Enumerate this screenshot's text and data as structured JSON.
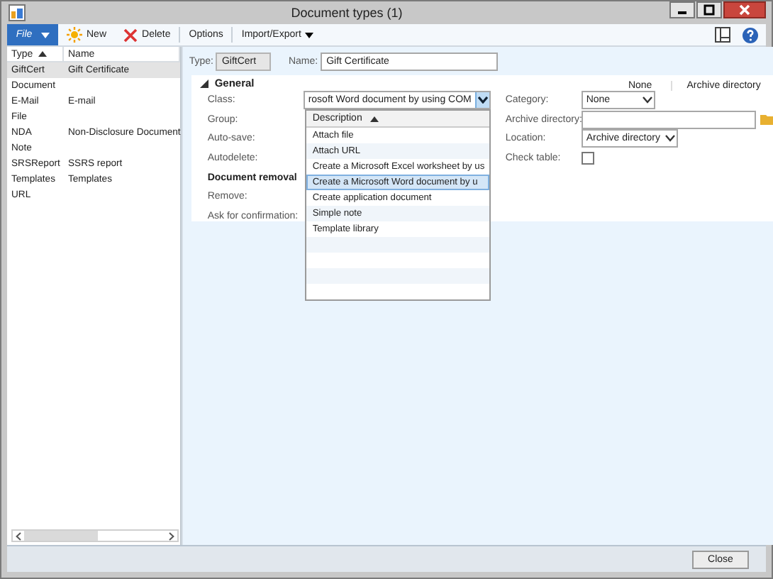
{
  "window": {
    "title": "Document types (1)"
  },
  "toolbar": {
    "file_menu": "File",
    "buttons": [
      {
        "kind": "new",
        "label": "New"
      },
      {
        "kind": "delete",
        "label": "Delete"
      },
      {
        "kind": "plain",
        "label": "Options"
      },
      {
        "kind": "menu",
        "label": "Import/Export"
      }
    ]
  },
  "list": {
    "columns": [
      "Type",
      "Name"
    ],
    "rows": [
      {
        "type": "GiftCert",
        "name": "Gift Certificate",
        "selected": true
      },
      {
        "type": "Document",
        "name": "",
        "selected": false
      },
      {
        "type": "E-Mail",
        "name": "E-mail",
        "selected": false
      },
      {
        "type": "File",
        "name": "",
        "selected": false
      },
      {
        "type": "NDA",
        "name": "Non-Disclosure Document",
        "selected": false
      },
      {
        "type": "Note",
        "name": "",
        "selected": false
      },
      {
        "type": "SRSReport",
        "name": "SSRS report",
        "selected": false
      },
      {
        "type": "Templates",
        "name": "Templates",
        "selected": false
      },
      {
        "type": "URL",
        "name": "",
        "selected": false
      }
    ]
  },
  "header": {
    "type_label": "Type:",
    "type_value": "GiftCert",
    "name_label": "Name:",
    "name_value": "Gift Certificate"
  },
  "general": {
    "title": "General",
    "expanded": true,
    "top_labels": [
      "None",
      "Archive directory"
    ],
    "left_fields": [
      {
        "kind": "combo",
        "label": "Class:",
        "value": "rosoft Word document by using COM"
      },
      {
        "kind": "label",
        "label": "Group:"
      },
      {
        "kind": "label",
        "label": "Auto-save:"
      },
      {
        "kind": "label",
        "label": "Autodelete:"
      },
      {
        "kind": "heading",
        "label": "Document removal"
      },
      {
        "kind": "label",
        "label": "Remove:"
      },
      {
        "kind": "label",
        "label": "Ask for confirmation:"
      }
    ],
    "right_fields": [
      {
        "kind": "combo",
        "label": "Category:",
        "value": "None"
      },
      {
        "kind": "folder",
        "label": "Archive directory:"
      },
      {
        "kind": "combo",
        "label": "Location:",
        "value": "Archive directory"
      },
      {
        "kind": "checkbox",
        "label": "Check table:",
        "checked": false
      }
    ]
  },
  "dropdown": {
    "column": "Description",
    "items": [
      {
        "label": "Attach file",
        "selected": false
      },
      {
        "label": "Attach URL",
        "selected": false
      },
      {
        "label": "Create a Microsoft Excel worksheet by us",
        "selected": false
      },
      {
        "label": "Create a Microsoft Word document by u",
        "selected": true
      },
      {
        "label": "Create application document",
        "selected": false
      },
      {
        "label": "Simple note",
        "selected": false
      },
      {
        "label": "Template library",
        "selected": false
      }
    ]
  },
  "footer": {
    "close": "Close"
  }
}
